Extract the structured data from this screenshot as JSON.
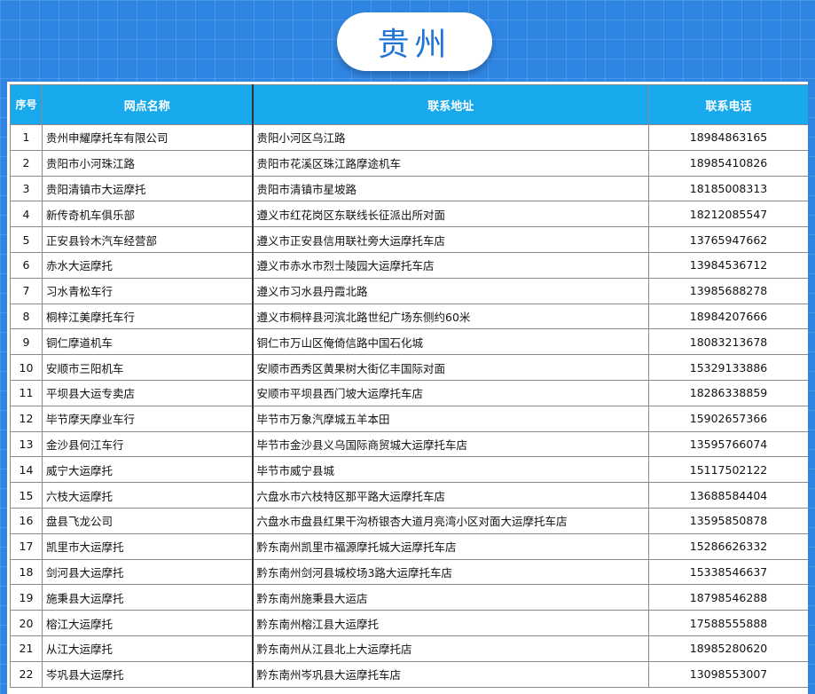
{
  "title": "贵州",
  "table": {
    "headers": {
      "seq": "序号",
      "name": "网点名称",
      "address": "联系地址",
      "phone": "联系电话"
    },
    "rows": [
      {
        "seq": "1",
        "name": "贵州申耀摩托车有限公司",
        "address": "贵阳小河区乌江路",
        "phone": "18984863165"
      },
      {
        "seq": "2",
        "name": "贵阳市小河珠江路",
        "address": "贵阳市花溪区珠江路摩途机车",
        "phone": "18985410826"
      },
      {
        "seq": "3",
        "name": "贵阳清镇市大运摩托",
        "address": "贵阳市清镇市星坡路",
        "phone": "18185008313"
      },
      {
        "seq": "4",
        "name": "新传奇机车俱乐部",
        "address": "遵义市红花岗区东联线长征派出所对面",
        "phone": "18212085547"
      },
      {
        "seq": "5",
        "name": "正安县铃木汽车经营部",
        "address": "遵义市正安县信用联社旁大运摩托车店",
        "phone": "13765947662"
      },
      {
        "seq": "6",
        "name": "赤水大运摩托",
        "address": "遵义市赤水市烈士陵园大运摩托车店",
        "phone": "13984536712"
      },
      {
        "seq": "7",
        "name": "习水青松车行",
        "address": "遵义市习水县丹霞北路",
        "phone": "13985688278"
      },
      {
        "seq": "8",
        "name": "桐梓江美摩托车行",
        "address": "遵义市桐梓县河滨北路世纪广场东侧约60米",
        "phone": "18984207666"
      },
      {
        "seq": "9",
        "name": "铜仁摩道机车",
        "address": "铜仁市万山区俺倚信路中国石化城",
        "phone": "18083213678"
      },
      {
        "seq": "10",
        "name": "安顺市三阳机车",
        "address": "安顺市西秀区黄果树大街亿丰国际对面",
        "phone": "15329133886"
      },
      {
        "seq": "11",
        "name": "平坝县大运专卖店",
        "address": "安顺市平坝县西门坡大运摩托车店",
        "phone": "18286338859"
      },
      {
        "seq": "12",
        "name": "毕节摩天摩业车行",
        "address": "毕节市万象汽摩城五羊本田",
        "phone": "15902657366"
      },
      {
        "seq": "13",
        "name": "金沙县何江车行",
        "address": "毕节市金沙县义乌国际商贸城大运摩托车店",
        "phone": "13595766074"
      },
      {
        "seq": "14",
        "name": "威宁大运摩托",
        "address": "毕节市威宁县城",
        "phone": "15117502122"
      },
      {
        "seq": "15",
        "name": "六枝大运摩托",
        "address": "六盘水市六枝特区那平路大运摩托车店",
        "phone": "13688584404"
      },
      {
        "seq": "16",
        "name": "盘县飞龙公司",
        "address": "六盘水市盘县红果干沟桥银杏大道月亮湾小区对面大运摩托车店",
        "phone": "13595850878"
      },
      {
        "seq": "17",
        "name": "凯里市大运摩托",
        "address": "黔东南州凯里市福源摩托城大运摩托车店",
        "phone": "15286626332"
      },
      {
        "seq": "18",
        "name": "剑河县大运摩托",
        "address": "黔东南州剑河县城校场3路大运摩托车店",
        "phone": "15338546637"
      },
      {
        "seq": "19",
        "name": "施秉县大运摩托",
        "address": "黔东南州施秉县大运店",
        "phone": "18798546288"
      },
      {
        "seq": "20",
        "name": "榕江大运摩托",
        "address": "黔东南州榕江县大运摩托",
        "phone": "17588555888"
      },
      {
        "seq": "21",
        "name": "从江大运摩托",
        "address": "黔东南州从江县北上大运摩托店",
        "phone": "18985280620"
      },
      {
        "seq": "22",
        "name": "岑巩县大运摩托",
        "address": "黔东南州岑巩县大运摩托车店",
        "phone": "13098553007"
      }
    ]
  }
}
